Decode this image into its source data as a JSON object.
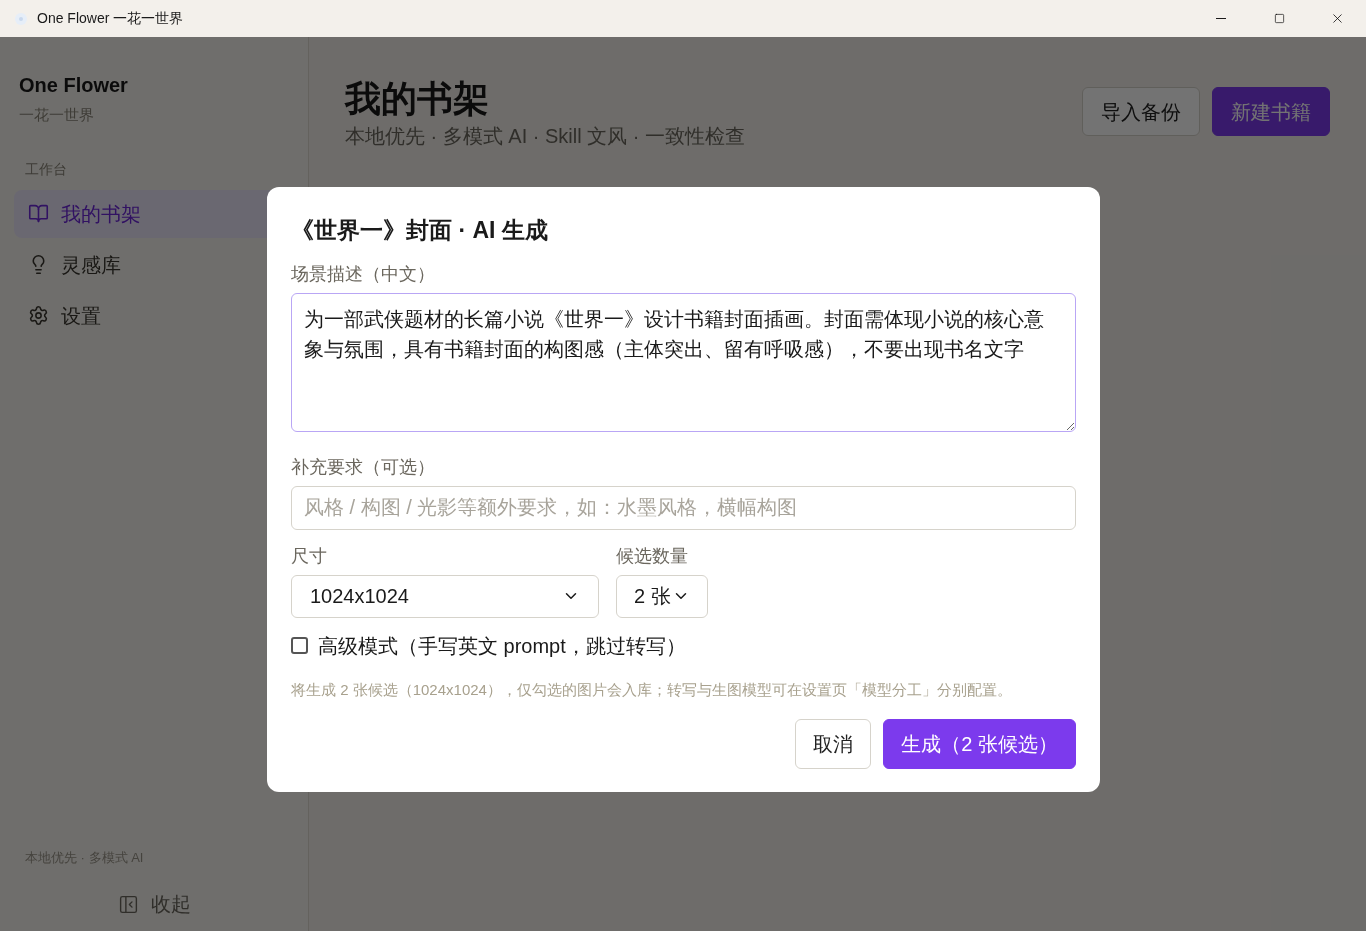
{
  "window": {
    "title": "One Flower 一花一世界"
  },
  "sidebar": {
    "app_name": "One Flower",
    "app_subtitle": "一花一世界",
    "section": "工作台",
    "items": [
      {
        "label": "我的书架",
        "selected": true
      },
      {
        "label": "灵感库",
        "selected": false
      },
      {
        "label": "设置",
        "selected": false
      }
    ],
    "footer": "本地优先 · 多模式 AI",
    "collapse": "收起"
  },
  "header": {
    "title": "我的书架",
    "subtitle": "本地优先 · 多模式 AI · Skill 文风 · 一致性检查",
    "buttons": [
      {
        "label": "导入备份",
        "kind": "secondary"
      },
      {
        "label": "新建书籍",
        "kind": "primary"
      }
    ]
  },
  "dialog": {
    "title": "《世界一》封面 · AI 生成",
    "scene_label": "场景描述（中文）",
    "scene_value": "为一部武侠题材的长篇小说《世界一》设计书籍封面插画。封面需体现小说的核心意象与氛围，具有书籍封面的构图感（主体突出、留有呼吸感），不要出现书名文字",
    "extra_label": "补充要求（可选）",
    "extra_placeholder": "风格 / 构图 / 光影等额外要求，如：水墨风格，横幅构图",
    "size_label": "尺寸",
    "size_value": "1024x1024",
    "count_label": "候选数量",
    "count_value": "2 张",
    "advanced": {
      "label": "高级模式（手写英文 prompt，跳过转写）",
      "checked": false
    },
    "hint": "将生成 2 张候选（1024x1024），仅勾选的图片会入库；转写与生图模型可在设置页「模型分工」分别配置。",
    "buttons": [
      {
        "label": "取消",
        "kind": "secondary"
      },
      {
        "label": "生成（2 张候选）",
        "kind": "primary"
      }
    ]
  }
}
